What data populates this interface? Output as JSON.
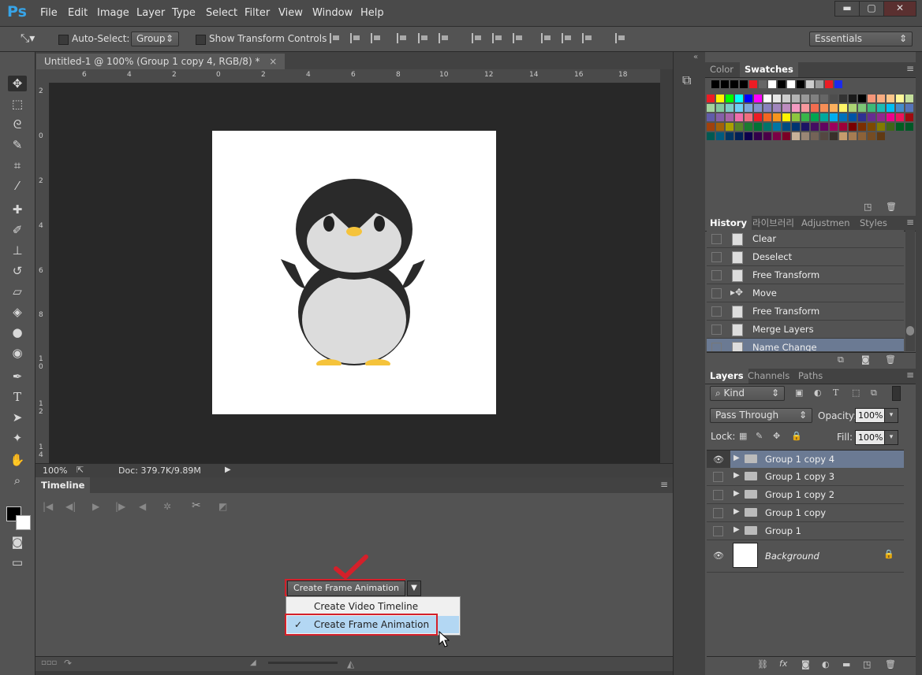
{
  "app": {
    "logo": "Ps"
  },
  "menu": [
    "File",
    "Edit",
    "Image",
    "Layer",
    "Type",
    "Select",
    "Filter",
    "View",
    "Window",
    "Help"
  ],
  "window_controls": {
    "minimize": "▬",
    "maximize": "▢",
    "close": "✕"
  },
  "options": {
    "auto_select_label": "Auto-Select:",
    "auto_select_value": "Group",
    "show_transform_label": "Show Transform Controls",
    "workspace": "Essentials"
  },
  "document": {
    "tab_title": "Untitled-1 @ 100% (Group 1 copy 4, RGB/8) *",
    "zoom": "100%",
    "doc_info": "Doc: 379.7K/9.89M",
    "ruler_top": [
      "6",
      "4",
      "2",
      "0",
      "2",
      "4",
      "6",
      "8",
      "10",
      "12",
      "14",
      "16",
      "18"
    ],
    "ruler_left": [
      "2",
      "0",
      "2",
      "4",
      "6",
      "8",
      "1\n0",
      "1\n2",
      "1\n4"
    ]
  },
  "timeline": {
    "title": "Timeline",
    "create_button": "Create Frame Animation",
    "menu_items": [
      {
        "label": "Create Video Timeline",
        "checked": false
      },
      {
        "label": "Create Frame Animation",
        "checked": true
      }
    ]
  },
  "panels": {
    "color_tabs": [
      "Color",
      "Swatches"
    ],
    "history_tabs": [
      "History",
      "라이브러리",
      "Adjustmen",
      "Styles"
    ],
    "history_items": [
      "Clear",
      "Deselect",
      "Free Transform",
      "Move",
      "Free Transform",
      "Merge Layers",
      "Name Change"
    ],
    "layers_tabs": [
      "Layers",
      "Channels",
      "Paths"
    ],
    "kind_filter": "Kind",
    "blend_mode": "Pass Through",
    "opacity_label": "Opacity:",
    "opacity_value": "100%",
    "lock_label": "Lock:",
    "fill_label": "Fill:",
    "fill_value": "100%",
    "layers": [
      {
        "name": "Group 1 copy 4",
        "visible": true,
        "selected": true,
        "type": "group"
      },
      {
        "name": "Group 1 copy 3",
        "visible": false,
        "selected": false,
        "type": "group"
      },
      {
        "name": "Group 1 copy 2",
        "visible": false,
        "selected": false,
        "type": "group"
      },
      {
        "name": "Group 1 copy",
        "visible": false,
        "selected": false,
        "type": "group"
      },
      {
        "name": "Group 1",
        "visible": false,
        "selected": false,
        "type": "group"
      },
      {
        "name": "Background",
        "visible": true,
        "selected": false,
        "type": "background"
      }
    ]
  },
  "colors": {
    "accent": "#37a4e8",
    "selection": "#6b7a93",
    "highlight": "#b3d7f3",
    "annotation": "#d4202a"
  }
}
